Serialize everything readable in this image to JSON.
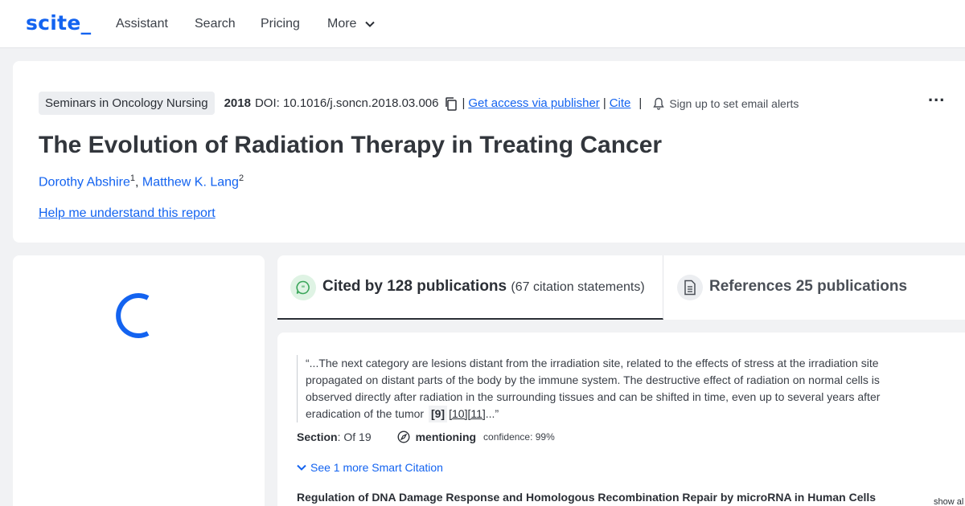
{
  "nav": {
    "logo": "scite_",
    "items": [
      "Assistant",
      "Search",
      "Pricing",
      "More"
    ]
  },
  "paper": {
    "journal": "Seminars in Oncology Nursing",
    "year": "2018",
    "doi": "DOI: 10.1016/j.soncn.2018.03.006",
    "access_link": "Get access via publisher",
    "cite_link": "Cite",
    "alert_text": "Sign up to set email alerts",
    "more_menu": "...",
    "title": "The Evolution of Radiation Therapy in Treating Cancer",
    "authors": [
      {
        "name": "Dorothy Abshire",
        "affiliation": "1"
      },
      {
        "name": "Matthew K. Lang",
        "affiliation": "2"
      }
    ],
    "help_link": "Help me understand this report"
  },
  "tabs": {
    "cited_label": "Cited by 128 publications",
    "cited_sub": "(67 citation statements)",
    "refs_label": "References 25 publications"
  },
  "citation": {
    "quote_text": "“...The next category are lesions distant from the irradiation site, related to the effects of stress at the irradiation site propagated on distant parts of the body by the immune system. The destructive effect of radiation on normal cells is observed directly after radiation in the surrounding tissues and can be shifted in time, even up to several years after eradication of the tumor",
    "ref_highlight": "[9]",
    "ref_links": "[10][11]",
    "quote_end": "...”",
    "section_label": "Section",
    "section_value": ": Of 19",
    "mention_label": "mentioning",
    "confidence": "confidence: 99%",
    "see_more": "See 1 more Smart Citation",
    "pub_title": "Regulation of DNA Damage Response and Homologous Recombination Repair by microRNA in Human Cells",
    "show_all": "show al"
  },
  "colors": {
    "brand": "#1363f0",
    "text": "#2b2f36",
    "cited_icon_bg": "#dff3e4",
    "cited_icon": "#3aa65a"
  },
  "icons": [
    "copy-icon",
    "bell-icon",
    "chevron-down-icon",
    "loading-spinner-icon",
    "chat-quote-icon",
    "document-icon",
    "compass-icon"
  ]
}
